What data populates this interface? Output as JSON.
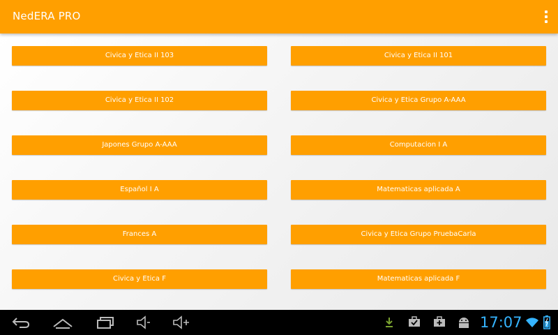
{
  "app": {
    "title": "NedERA PRO"
  },
  "buttons": [
    "Civica y Etica II 103",
    "Civica y Etica II 101",
    "Civica y Etica II 102",
    "Civica y Etica Grupo A-AAA",
    "Japones Grupo A-AAA",
    "Computacion I A",
    "Español I A",
    "Matematicas aplicada A",
    "Frances A",
    "Civica y Etica Grupo PruebaCarla",
    "Civica y Etica F",
    "Matematicas aplicada F"
  ],
  "status": {
    "time": "17:07"
  },
  "colors": {
    "accent": "#ff9f00",
    "clock": "#35b4ff",
    "navbar": "#000000"
  },
  "icons": [
    "back-icon",
    "home-icon",
    "recent-apps-icon",
    "volume-down-icon",
    "volume-up-icon",
    "download-icon",
    "briefcase-check-icon",
    "briefcase-plus-icon",
    "android-icon",
    "wifi-icon",
    "battery-icon"
  ]
}
